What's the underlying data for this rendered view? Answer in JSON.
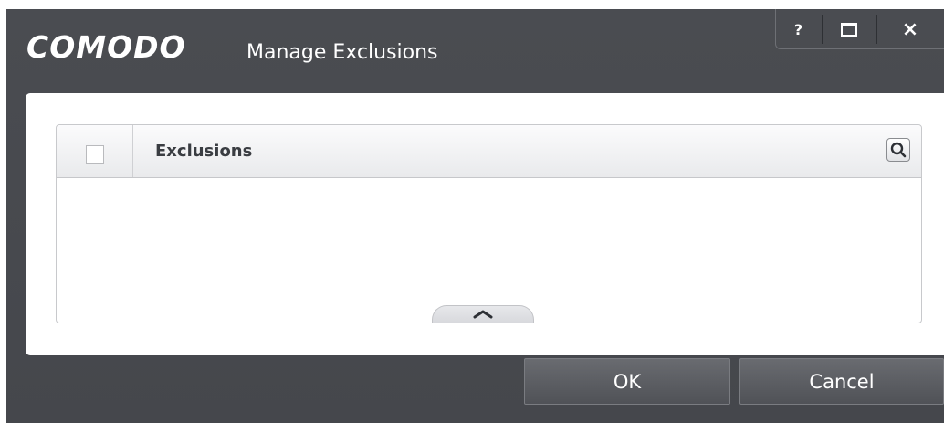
{
  "window": {
    "brand": "COMODO",
    "title": "Manage Exclusions",
    "controls": {
      "help_label": "?",
      "close_label": "×"
    }
  },
  "table": {
    "column_header": "Exclusions",
    "rows": []
  },
  "footer": {
    "ok_label": "OK",
    "cancel_label": "Cancel"
  },
  "icons": {
    "help": "help-icon",
    "maximize": "maximize-icon",
    "close": "close-icon",
    "search": "search-icon",
    "collapse": "chevron-up-icon"
  },
  "colors": {
    "window_bg": "#484a4f",
    "panel_bg": "#ffffff",
    "button_bg": "#5c5e63",
    "header_text": "#3a3d42"
  }
}
